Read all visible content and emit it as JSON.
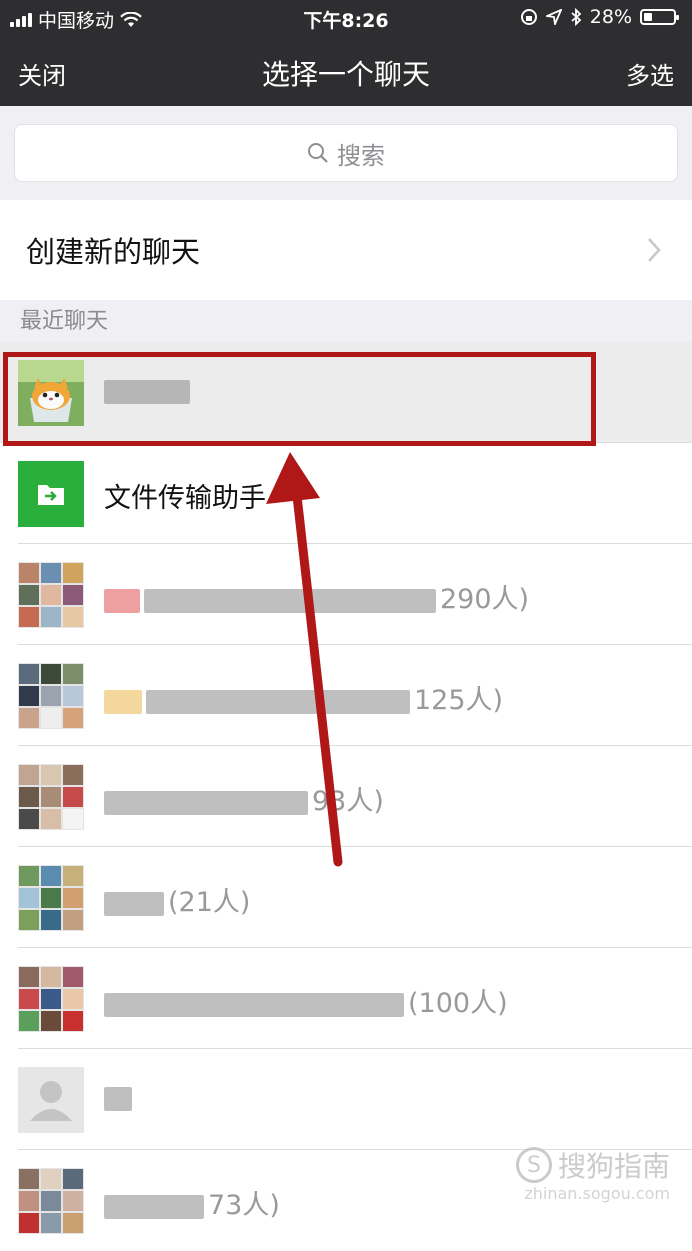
{
  "status_bar": {
    "carrier": "中国移动",
    "time": "下午8:26",
    "battery": "28%",
    "battery_level": 0.28
  },
  "nav": {
    "close_label": "关闭",
    "title": "选择一个聊天",
    "multi_select_label": "多选"
  },
  "search": {
    "placeholder": "搜索"
  },
  "create_chat": {
    "label": "创建新的聊天"
  },
  "recent": {
    "section_title": "最近聊天",
    "chats": [
      {
        "name": "",
        "count": "",
        "avatar": "cat-cup-photo"
      },
      {
        "name": "文件传输助手",
        "count": "",
        "avatar": "file-transfer-icon"
      },
      {
        "name": "",
        "count": "290人)",
        "avatar": "group-grid"
      },
      {
        "name": "",
        "count": "125人)",
        "avatar": "group-grid"
      },
      {
        "name": "",
        "count": "93人)",
        "avatar": "group-grid"
      },
      {
        "name": "",
        "count": "(21人)",
        "avatar": "group-grid"
      },
      {
        "name": "",
        "count": "(100人)",
        "avatar": "group-grid"
      },
      {
        "name": "",
        "count": "",
        "avatar": "default-person-icon"
      },
      {
        "name": "",
        "count": "73人)",
        "avatar": "group-grid"
      }
    ]
  },
  "watermark": {
    "text": "搜狗指南",
    "url": "zhinan.sogou.com"
  },
  "colors": {
    "nav_bg": "#2e2e30",
    "highlight": "#b01717",
    "file_transfer_green": "#2aae3c"
  }
}
